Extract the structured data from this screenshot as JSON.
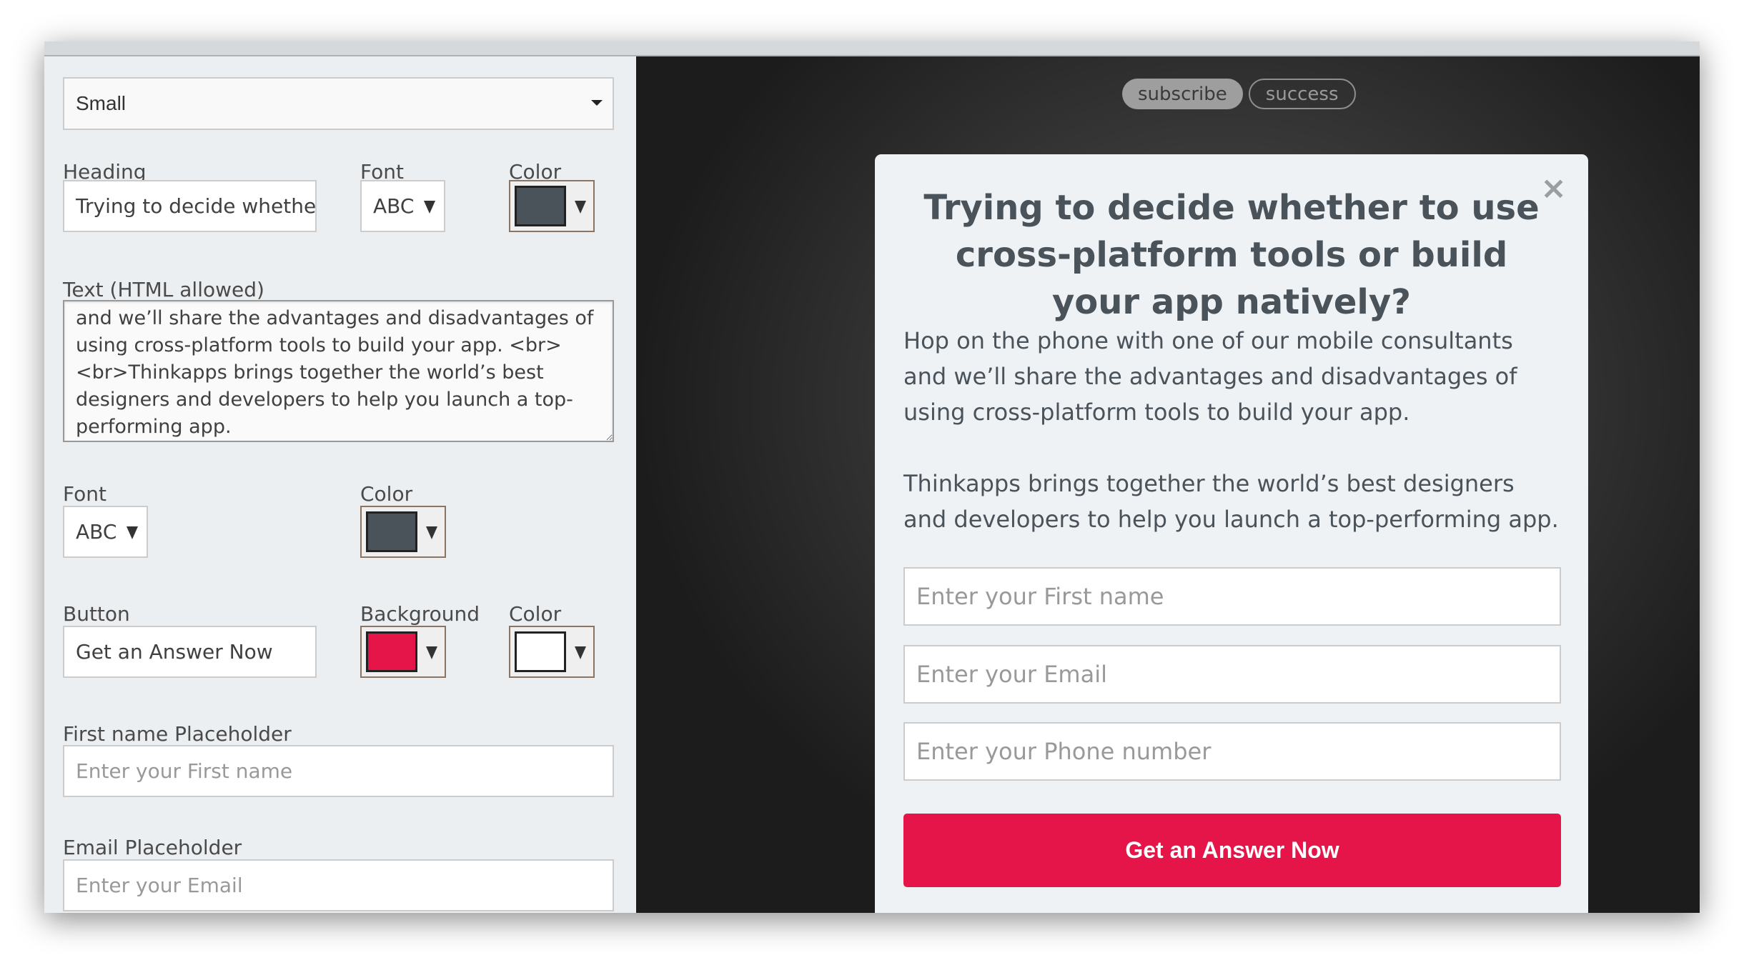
{
  "toolbar": {
    "tabs": [
      {
        "label": "subscribe",
        "active": true
      },
      {
        "label": "success",
        "active": false
      }
    ]
  },
  "editor": {
    "size_select": {
      "value": "Small"
    },
    "heading": {
      "label": "Heading",
      "value": "Trying to decide whether to use cross-platform tools or build your app natively?",
      "font_label": "Font",
      "font_value": "ABC",
      "color_label": "Color",
      "color": "#4a525a"
    },
    "text": {
      "label": "Text (HTML allowed)",
      "value": "Hop on the phone with one of our mobile consultants and we’ll share the advantages and disadvantages of using cross-platform tools to build your app. <br><br>Thinkapps brings together the world’s best designers and developers to help you launch a top-performing app.",
      "font_label": "Font",
      "font_value": "ABC",
      "color_label": "Color",
      "color": "#4a525a"
    },
    "button": {
      "label": "Button",
      "value": "Get an Answer Now",
      "background_label": "Background",
      "background": "#e5154a",
      "color_label": "Color",
      "color": "#ffffff"
    },
    "first_name_placeholder": {
      "label": "First name Placeholder",
      "placeholder": "Enter your First name"
    },
    "email_placeholder": {
      "label": "Email Placeholder",
      "placeholder": "Enter your Email"
    }
  },
  "preview": {
    "close_icon": "×",
    "heading": "Trying to decide whether to use cross-platform tools or build your app natively?",
    "paragraphs": [
      "Hop on the phone with one of our mobile consultants and we’ll share the advantages and disadvantages of using cross-platform tools to build your app.",
      "Thinkapps brings together the world’s best designers and developers to help you launch a top-performing app."
    ],
    "inputs": [
      {
        "placeholder": "Enter your First name"
      },
      {
        "placeholder": "Enter your Email"
      },
      {
        "placeholder": "Enter your Phone number"
      }
    ],
    "submit_label": "Get an Answer Now",
    "accent": "#e5154a"
  }
}
